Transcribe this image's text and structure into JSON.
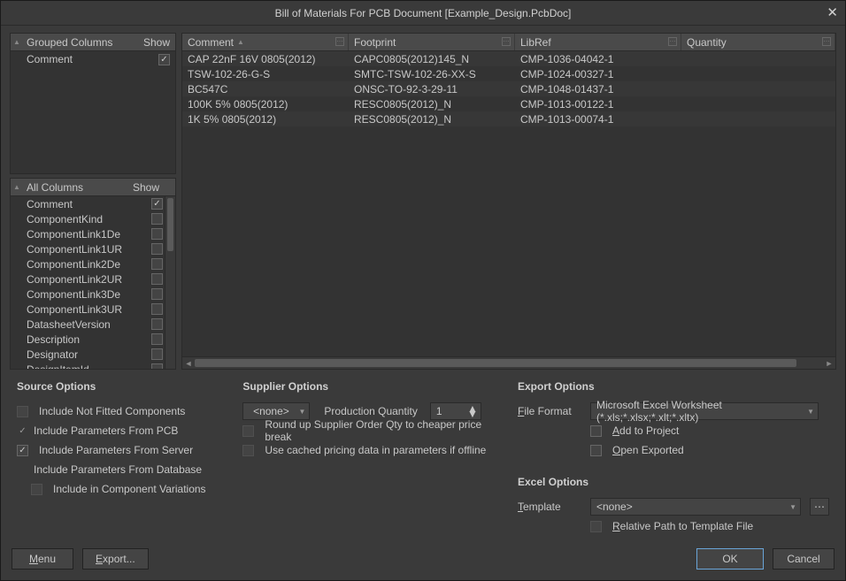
{
  "title": "Bill of Materials For PCB Document [Example_Design.PcbDoc]",
  "groupedHeader": {
    "col": "Grouped Columns",
    "show": "Show"
  },
  "groupedRows": [
    {
      "label": "Comment",
      "checked": true
    }
  ],
  "allColsHeader": {
    "col": "All Columns",
    "show": "Show"
  },
  "allCols": [
    {
      "label": "Comment",
      "checked": true
    },
    {
      "label": "ComponentKind",
      "checked": false
    },
    {
      "label": "ComponentLink1De",
      "checked": false
    },
    {
      "label": "ComponentLink1UR",
      "checked": false
    },
    {
      "label": "ComponentLink2De",
      "checked": false
    },
    {
      "label": "ComponentLink2UR",
      "checked": false
    },
    {
      "label": "ComponentLink3De",
      "checked": false
    },
    {
      "label": "ComponentLink3UR",
      "checked": false
    },
    {
      "label": "DatasheetVersion",
      "checked": false
    },
    {
      "label": "Description",
      "checked": false
    },
    {
      "label": "Designator",
      "checked": false
    },
    {
      "label": "DesignItemId",
      "checked": false
    }
  ],
  "gridHeaders": {
    "h0": "Comment",
    "h1": "Footprint",
    "h2": "LibRef",
    "h3": "Quantity"
  },
  "gridRows": [
    {
      "c0": "CAP 22nF 16V 0805(2012)",
      "c1": "CAPC0805(2012)145_N",
      "c2": "CMP-1036-04042-1",
      "c3": ""
    },
    {
      "c0": "TSW-102-26-G-S",
      "c1": "SMTC-TSW-102-26-XX-S",
      "c2": "CMP-1024-00327-1",
      "c3": ""
    },
    {
      "c0": "BC547C",
      "c1": "ONSC-TO-92-3-29-11",
      "c2": "CMP-1048-01437-1",
      "c3": ""
    },
    {
      "c0": "100K 5% 0805(2012)",
      "c1": "RESC0805(2012)_N",
      "c2": "CMP-1013-00122-1",
      "c3": ""
    },
    {
      "c0": "1K 5% 0805(2012)",
      "c1": "RESC0805(2012)_N",
      "c2": "CMP-1013-00074-1",
      "c3": ""
    }
  ],
  "sourceOptions": {
    "title": "Source Options",
    "o1": "Include Not Fitted Components",
    "o2": "Include Parameters From PCB",
    "o3": "Include Parameters From Server",
    "o4": "Include Parameters From Database",
    "o5": "Include in Component Variations"
  },
  "supplierOptions": {
    "title": "Supplier Options",
    "dd": "<none>",
    "pqLabel": "Production Quantity",
    "pqVal": "1",
    "o1": "Round up Supplier Order Qty to cheaper price break",
    "o2": "Use cached pricing data in parameters if offline"
  },
  "exportOptions": {
    "title": "Export Options",
    "ffLabel1": "F",
    "ffLabel2": "ile Format",
    "ffVal": "Microsoft Excel Worksheet (*.xls;*.xlsx;*.xlt;*.xltx)",
    "addPre": "A",
    "addPost": "dd to Project",
    "openPre": "O",
    "openPost": "pen Exported"
  },
  "excelOptions": {
    "title": "Excel Options",
    "tplPre": "T",
    "tplPost": "emplate",
    "tplVal": "<none>",
    "relPre": "R",
    "relPost": "elative Path to Template File"
  },
  "footer": {
    "menuPre": "M",
    "menuPost": "enu",
    "exportPre": "E",
    "exportPost": "xport...",
    "ok": "OK",
    "cancel": "Cancel"
  }
}
